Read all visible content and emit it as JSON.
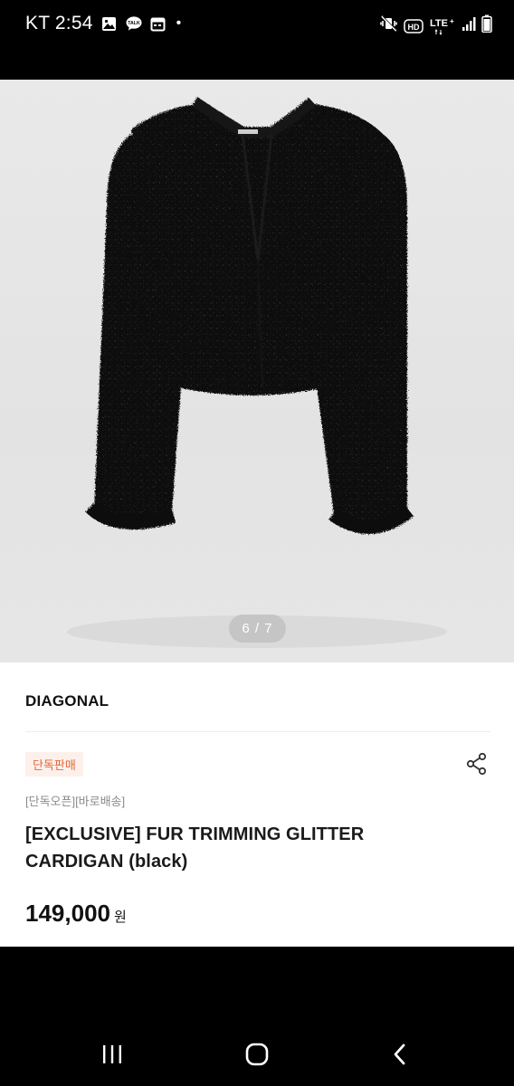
{
  "status_bar": {
    "carrier": "KT",
    "time": "2:54",
    "left_icons": [
      "gallery-icon",
      "talk-icon",
      "calendar-icon"
    ],
    "right_icons": [
      "mute-vibrate-icon",
      "hd-icon",
      "lte-icon",
      "signal-icon",
      "battery-icon"
    ],
    "hd_label": "HD",
    "lte_label": "LTE"
  },
  "gallery": {
    "pager": "6 / 7",
    "current": 6,
    "total": 7
  },
  "product": {
    "brand": "DIAGONAL",
    "badge": "단독판매",
    "tags": "[단독오픈][바로배송]",
    "title_line1": "[EXCLUSIVE] FUR TRIMMING GLITTER",
    "title_line2": "CARDIGAN (black)",
    "price": "149,000",
    "currency": "원"
  },
  "colors": {
    "badge_text": "#e2683a",
    "badge_bg": "#fdf0ea"
  },
  "nav": {
    "items": [
      "recents-icon",
      "home-icon",
      "back-icon"
    ]
  }
}
